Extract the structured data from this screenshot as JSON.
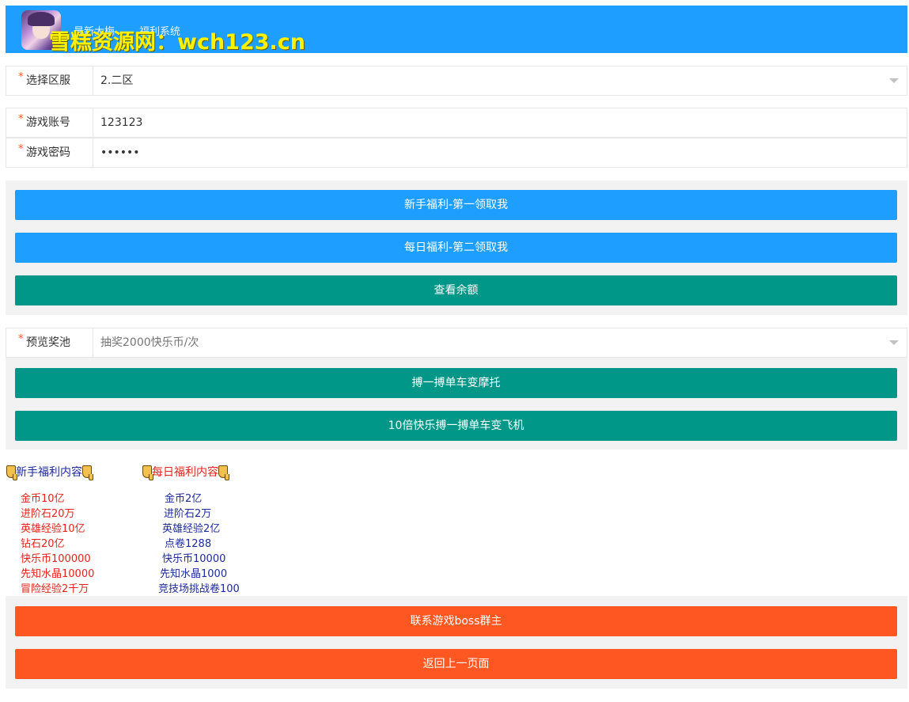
{
  "header": {
    "game_name": "最新大梅",
    "system_name": "福利系统",
    "watermark": "雪糕资源网：wch123.cn"
  },
  "form": {
    "server": {
      "label": "选择区服",
      "value": "2.二区"
    },
    "account": {
      "label": "游戏账号",
      "value": "123123"
    },
    "password": {
      "label": "游戏密码",
      "value": "••••••"
    }
  },
  "buttons": {
    "newbie": "新手福利-第一领取我",
    "daily": "每日福利-第二领取我",
    "balance": "查看余额"
  },
  "prize_pool": {
    "label": "预览奖池",
    "placeholder": "抽奖2000快乐币/次",
    "draw": "搏一搏单车变摩托",
    "draw10": "10倍快乐搏一搏单车变飞机"
  },
  "rewards": {
    "newbie_title": "新手福利内容",
    "daily_title": "每日福利内容",
    "newbie_items": [
      "金币10亿",
      "进阶石20万",
      "英雄经验10亿",
      "钻石20亿",
      "快乐币100000",
      "先知水晶10000",
      "冒险经验2千万"
    ],
    "daily_items": [
      " 金币2亿",
      " 进阶石2万",
      "英雄经验2亿",
      " 点卷1288",
      "快乐币10000",
      "先知水晶1000",
      "竞技场挑战卷100"
    ]
  },
  "footer": {
    "contact": "联系游戏boss群主",
    "back": "返回上一页面"
  },
  "colors": {
    "blue": "#1e9fff",
    "green": "#009688",
    "orange": "#ff5722",
    "red_text": "#e3241b",
    "navy_text": "#1d2a9c"
  }
}
